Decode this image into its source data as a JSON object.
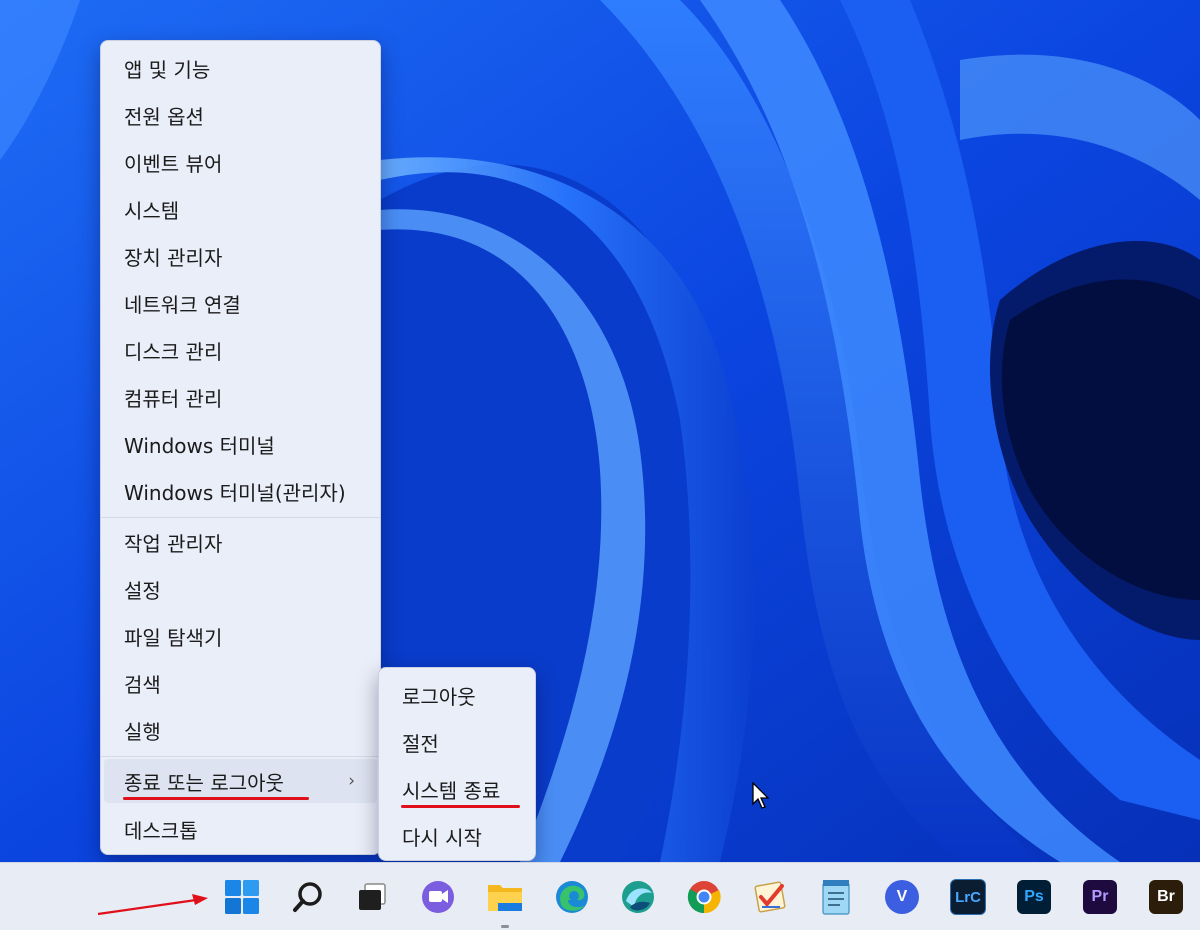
{
  "menu": {
    "items": [
      {
        "label": "앱 및 기능"
      },
      {
        "label": "전원 옵션"
      },
      {
        "label": "이벤트 뷰어"
      },
      {
        "label": "시스템"
      },
      {
        "label": "장치 관리자"
      },
      {
        "label": "네트워크 연결"
      },
      {
        "label": "디스크 관리"
      },
      {
        "label": "컴퓨터 관리"
      },
      {
        "label": "Windows 터미널"
      },
      {
        "label": "Windows 터미널(관리자)"
      },
      {
        "label": "작업 관리자"
      },
      {
        "label": "설정"
      },
      {
        "label": "파일 탐색기"
      },
      {
        "label": "검색"
      },
      {
        "label": "실행"
      },
      {
        "label": "종료 또는 로그아웃"
      },
      {
        "label": "데스크톱"
      }
    ],
    "chevron": "›"
  },
  "submenu": {
    "items": [
      {
        "label": "로그아웃"
      },
      {
        "label": "절전"
      },
      {
        "label": "시스템 종료"
      },
      {
        "label": "다시 시작"
      }
    ]
  },
  "taskbar": {
    "icons": [
      {
        "name": "start-icon"
      },
      {
        "name": "search-icon"
      },
      {
        "name": "task-view-icon"
      },
      {
        "name": "chat-icon"
      },
      {
        "name": "file-explorer-icon"
      },
      {
        "name": "edge-icon"
      },
      {
        "name": "app-swirl-icon"
      },
      {
        "name": "chrome-icon"
      },
      {
        "name": "checklist-icon"
      },
      {
        "name": "notepad-icon"
      },
      {
        "name": "v-app-icon",
        "text": "V"
      },
      {
        "name": "lightroom-classic-icon",
        "text": "LrC"
      },
      {
        "name": "photoshop-icon",
        "text": "Ps"
      },
      {
        "name": "premiere-icon",
        "text": "Pr"
      },
      {
        "name": "bridge-icon",
        "text": "Br"
      }
    ]
  },
  "colors": {
    "annotation_red": "#e0101a",
    "wallpaper_blue": "#0a3fd8",
    "menu_bg": "#eaeef9"
  }
}
